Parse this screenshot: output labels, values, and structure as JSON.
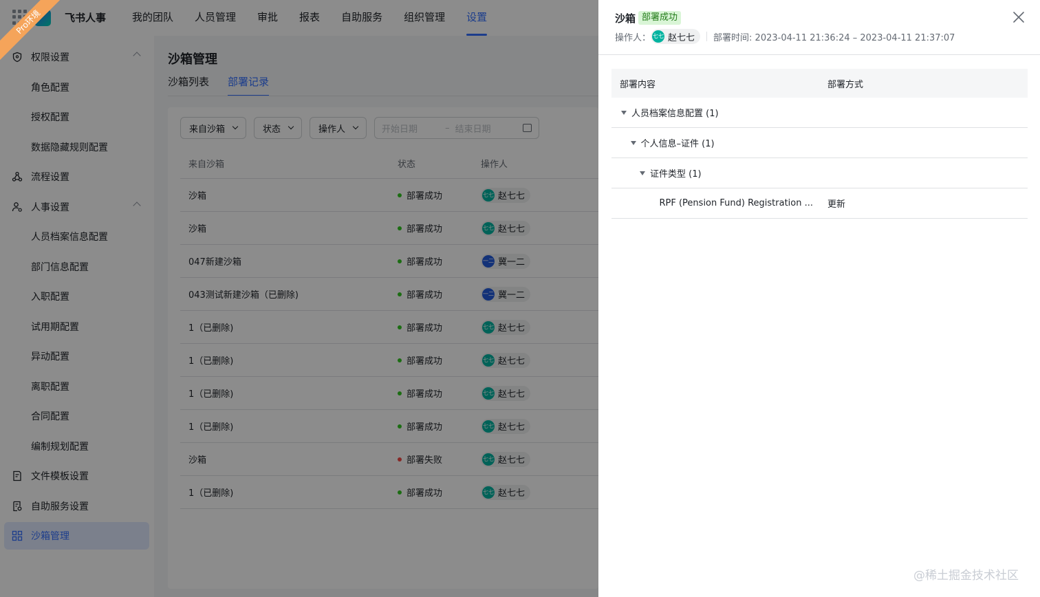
{
  "header": {
    "brand": "飞书人事",
    "nav": [
      "我的团队",
      "人员管理",
      "审批",
      "报表",
      "自助服务",
      "组织管理",
      "设置"
    ],
    "active_nav": "设置",
    "ribbon": "Pro环境"
  },
  "sidebar": {
    "items": [
      {
        "label": "权限设置",
        "icon": "shield-icon",
        "type": "group",
        "expanded": true
      },
      {
        "label": "角色配置",
        "type": "child"
      },
      {
        "label": "授权配置",
        "type": "child"
      },
      {
        "label": "数据隐藏规则配置",
        "type": "child"
      },
      {
        "label": "流程设置",
        "icon": "flow-icon",
        "type": "group"
      },
      {
        "label": "人事设置",
        "icon": "user-settings-icon",
        "type": "group",
        "expanded": true
      },
      {
        "label": "人员档案信息配置",
        "type": "child"
      },
      {
        "label": "部门信息配置",
        "type": "child"
      },
      {
        "label": "入职配置",
        "type": "child"
      },
      {
        "label": "试用期配置",
        "type": "child"
      },
      {
        "label": "异动配置",
        "type": "child"
      },
      {
        "label": "离职配置",
        "type": "child"
      },
      {
        "label": "合同配置",
        "type": "child"
      },
      {
        "label": "编制规划配置",
        "type": "child"
      },
      {
        "label": "文件模板设置",
        "icon": "file-template-icon",
        "type": "group"
      },
      {
        "label": "自助服务设置",
        "icon": "self-service-icon",
        "type": "group"
      },
      {
        "label": "沙箱管理",
        "icon": "grid-icon",
        "type": "group",
        "active": true
      }
    ]
  },
  "main": {
    "title": "沙箱管理",
    "tabs": [
      "沙箱列表",
      "部署记录"
    ],
    "active_tab": "部署记录",
    "filters": [
      "来自沙箱",
      "状态",
      "操作人"
    ],
    "date_start_placeholder": "开始日期",
    "date_sep": "–",
    "date_end_placeholder": "结束日期",
    "columns": [
      "来自沙箱",
      "状态",
      "操作人"
    ],
    "rows": [
      {
        "source": "沙箱",
        "status": "部署成功",
        "ok": true,
        "operator": "赵七七",
        "avatar": "七七"
      },
      {
        "source": "沙箱",
        "status": "部署成功",
        "ok": true,
        "operator": "赵七七",
        "avatar": "七七"
      },
      {
        "source": "047新建沙箱",
        "status": "部署成功",
        "ok": true,
        "operator": "冀一二",
        "avatar": "一二"
      },
      {
        "source": "043测试新建沙箱（已删除)",
        "status": "部署成功",
        "ok": true,
        "operator": "冀一二",
        "avatar": "一二"
      },
      {
        "source": "1（已删除)",
        "status": "部署成功",
        "ok": true,
        "operator": "赵七七",
        "avatar": "七七"
      },
      {
        "source": "1（已删除)",
        "status": "部署成功",
        "ok": true,
        "operator": "赵七七",
        "avatar": "七七"
      },
      {
        "source": "1（已删除)",
        "status": "部署成功",
        "ok": true,
        "operator": "赵七七",
        "avatar": "七七"
      },
      {
        "source": "1（已删除)",
        "status": "部署成功",
        "ok": true,
        "operator": "赵七七",
        "avatar": "七七"
      },
      {
        "source": "沙箱",
        "status": "部署失败",
        "ok": false,
        "operator": "赵七七",
        "avatar": "七七"
      },
      {
        "source": "1（已删除)",
        "status": "部署成功",
        "ok": true,
        "operator": "赵七七",
        "avatar": "七七"
      }
    ]
  },
  "drawer": {
    "title": "沙箱",
    "badge": "部署成功",
    "operator_label": "操作人：",
    "operator_avatar": "七七",
    "operator_name": "赵七七",
    "deploy_time": "部署时间: 2023-04-11 21:36:24 – 2023-04-11 21:37:07",
    "columns": [
      "部署内容",
      "部署方式"
    ],
    "tree": [
      {
        "label": "人员档案信息配置 (1)",
        "level": 0,
        "expandable": true,
        "method": ""
      },
      {
        "label": "个人信息–证件 (1)",
        "level": 1,
        "expandable": true,
        "method": ""
      },
      {
        "label": "证件类型 (1)",
        "level": 2,
        "expandable": true,
        "method": ""
      },
      {
        "label": "RPF (Pension Fund) Registration ...",
        "level": 3,
        "expandable": false,
        "method": "更新"
      }
    ]
  },
  "watermark": "@稀土掘金技术社区",
  "colors": {
    "primary": "#3370ff",
    "success": "#34c724",
    "danger": "#f54a45",
    "avatar_teal": "#00b3a0",
    "avatar_blue": "#245bdb"
  }
}
